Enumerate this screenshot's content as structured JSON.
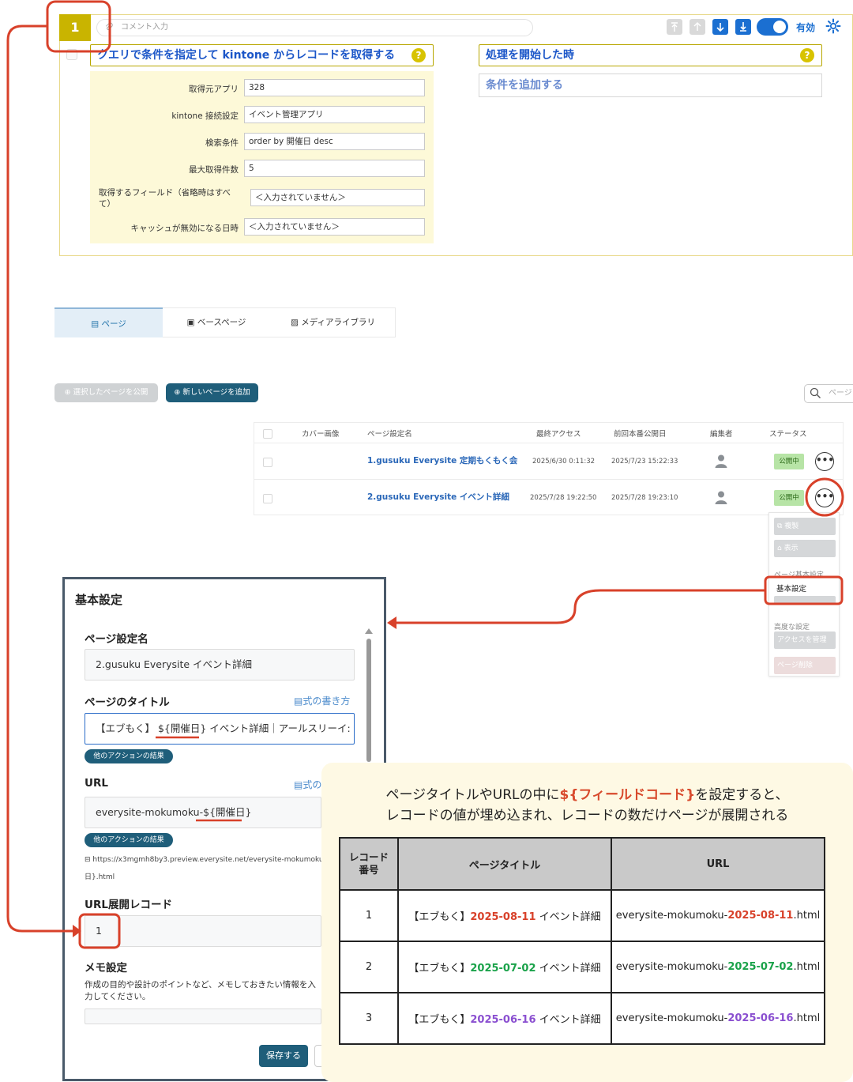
{
  "kintone_block": {
    "step_number": "1",
    "comment_placeholder": "コメント入力",
    "enabled_label": "有効",
    "query_title": "クエリで条件を指定して kintone からレコードを取得する",
    "process_title": "処理を開始した時",
    "add_condition": "条件を追加する",
    "help_glyph": "?",
    "fields": [
      {
        "label": "取得元アプリ",
        "value": "328"
      },
      {
        "label": "kintone 接続設定",
        "value": "イベント管理アプリ"
      },
      {
        "label": "検索条件",
        "value": "order by 開催日 desc"
      },
      {
        "label": "最大取得件数",
        "value": "5"
      },
      {
        "label": "取得するフィールド（省略時はすべて）",
        "value": "＜入力されていません＞"
      },
      {
        "label": "キャッシュが無効になる日時",
        "value": "＜入力されていません＞"
      }
    ]
  },
  "tabs": [
    {
      "label": "ページ",
      "active": true
    },
    {
      "label": "ベースページ",
      "active": false
    },
    {
      "label": "メディアライブラリ",
      "active": false
    }
  ],
  "actions": {
    "publish_selected": "選択したページを公開",
    "add_page": "新しいページを追加",
    "search_placeholder": "ページ"
  },
  "page_table": {
    "headers": [
      "カバー画像",
      "ページ設定名",
      "最終アクセス",
      "前回本番公開日",
      "編集者",
      "ステータス"
    ],
    "rows": [
      {
        "name": "1.gusuku Everysite 定期もくもく会",
        "last_access": "2025/6/30 0:11:32",
        "last_publish": "2025/7/23 15:22:33",
        "status": "公開中"
      },
      {
        "name": "2.gusuku Everysite イベント詳細",
        "last_access": "2025/7/28 19:22:50",
        "last_publish": "2025/7/28 19:23:10",
        "status": "公開中"
      }
    ],
    "more_glyph": "•••"
  },
  "row_menu": {
    "copy": "複製",
    "view": "表示",
    "basic_section": "ページ基本設定",
    "basic_settings": "基本設定",
    "advanced_section": "高度な設定",
    "access": "アクセスを管理",
    "delete": "ページ削除"
  },
  "basic_panel": {
    "title": "基本設定",
    "page_name_label": "ページ設定名",
    "page_name_value": "2.gusuku Everysite イベント詳細",
    "page_title_label": "ページのタイトル",
    "formula_link": "式の書き方",
    "formula_link_short": "式の",
    "page_title_value": "【エブもく】 ${開催日} イベント詳細｜アールスリーイ:",
    "other_action_pill": "他のアクションの結果",
    "url_label": "URL",
    "url_value": "everysite-mokumoku-${開催日}",
    "url_preview_line1": "https://x3mgmh8by3.preview.everysite.net/everysite-mokumoku",
    "url_preview_line2": "日}.html",
    "record_label": "URL展開レコード",
    "record_value": "1",
    "memo_label": "メモ設定",
    "memo_desc": "作成の目的や設計のポイントなど、メモしておきたい情報を入力してください。",
    "save": "保存する"
  },
  "callout": {
    "line1_pre": "ページタイトルやURLの中に",
    "line1_hl": "${フィールドコード}",
    "line1_post": "を設定すると、",
    "line2": "レコードの値が埋め込まれ、レコードの数だけページが展開される",
    "headers": [
      "レコード番号",
      "ページタイトル",
      "URL"
    ],
    "rows": [
      {
        "no": "1",
        "title_pre": "【エブもく】",
        "date": "2025-08-11",
        "title_post": " イベント詳細",
        "url_pre": "everysite-mokumoku-",
        "url_post": ".html"
      },
      {
        "no": "2",
        "title_pre": "【エブもく】",
        "date": "2025-07-02",
        "title_post": " イベント詳細",
        "url_pre": "everysite-mokumoku-",
        "url_post": ".html"
      },
      {
        "no": "3",
        "title_pre": "【エブもく】",
        "date": "2025-06-16",
        "title_post": " イベント詳細",
        "url_pre": "everysite-mokumoku-",
        "url_post": ".html"
      }
    ]
  },
  "colors": {
    "accent_blue": "#1b6fd1",
    "teal": "#1f5e7a",
    "annotation_red": "#d8412a",
    "date_red": "#d8412a",
    "date_green": "#1aa24a",
    "date_purple": "#8a4fd0"
  }
}
